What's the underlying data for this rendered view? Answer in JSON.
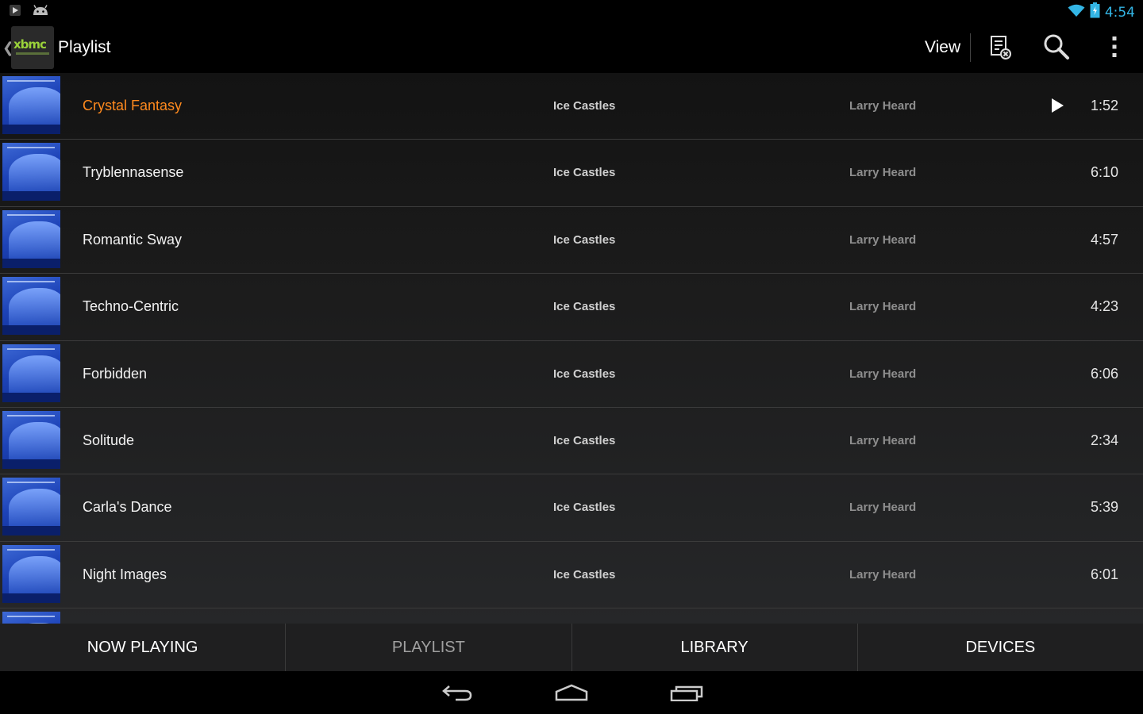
{
  "status_bar": {
    "time": "4:54",
    "left_icons": [
      "play-notification-icon",
      "android-robot-icon"
    ],
    "right_icons": [
      "wifi-icon",
      "battery-icon"
    ]
  },
  "action_bar": {
    "title": "Playlist",
    "view_label": "View",
    "icons": [
      "clear-playlist-icon",
      "search-icon",
      "overflow-menu-icon"
    ]
  },
  "playlist": {
    "items": [
      {
        "title": "Crystal Fantasy",
        "album": "Ice Castles",
        "artist": "Larry Heard",
        "duration": "1:52",
        "playing": true
      },
      {
        "title": "Tryblennasense",
        "album": "Ice Castles",
        "artist": "Larry Heard",
        "duration": "6:10",
        "playing": false
      },
      {
        "title": "Romantic Sway",
        "album": "Ice Castles",
        "artist": "Larry Heard",
        "duration": "4:57",
        "playing": false
      },
      {
        "title": "Techno-Centric",
        "album": "Ice Castles",
        "artist": "Larry Heard",
        "duration": "4:23",
        "playing": false
      },
      {
        "title": "Forbidden",
        "album": "Ice Castles",
        "artist": "Larry Heard",
        "duration": "6:06",
        "playing": false
      },
      {
        "title": "Solitude",
        "album": "Ice Castles",
        "artist": "Larry Heard",
        "duration": "2:34",
        "playing": false
      },
      {
        "title": "Carla's Dance",
        "album": "Ice Castles",
        "artist": "Larry Heard",
        "duration": "5:39",
        "playing": false
      },
      {
        "title": "Night Images",
        "album": "Ice Castles",
        "artist": "Larry Heard",
        "duration": "6:01",
        "playing": false
      }
    ]
  },
  "tabs": [
    {
      "label": "NOW PLAYING",
      "active": false
    },
    {
      "label": "PLAYLIST",
      "active": true
    },
    {
      "label": "LIBRARY",
      "active": false
    },
    {
      "label": "DEVICES",
      "active": false
    }
  ],
  "nav_bar": {
    "icons": [
      "back-icon",
      "home-icon",
      "recents-icon"
    ]
  },
  "colors": {
    "accent_playing": "#ff8a1e",
    "status_blue": "#33b5e5",
    "background": "#000000",
    "tab_bar": "#1f1f20"
  }
}
